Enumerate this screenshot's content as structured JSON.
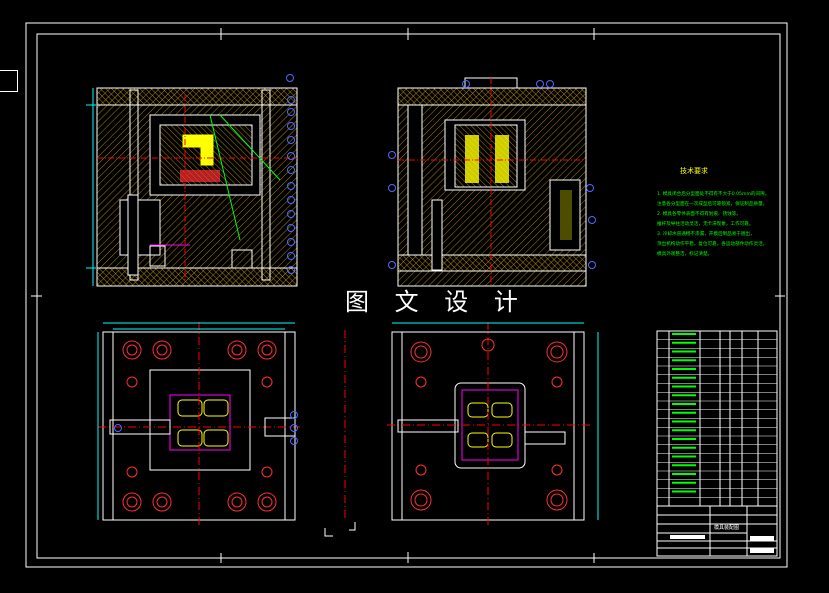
{
  "watermark": "图 文 设 计",
  "tech_requirements": {
    "title": "技术要求",
    "lines": [
      "1. 模具闭合后分型面处不得有不大于0.05mm的间隙。",
      "注意各分型面在一次成型后可靠锁紧，保证制品质量。",
      "2. 模具各零件表面不得有划痕、锈蚀等。",
      "推杆及导柱活动灵活，无卡滞现象，工作可靠。",
      "3. 冷却水道通畅不渗漏，开模后制品易于脱出，",
      "顶出机构动作平稳，复位可靠，各运动部件动作灵活，",
      "模具外观整洁，标记清楚。"
    ]
  },
  "title_block": {
    "drawing_name": "模具装配图"
  },
  "bom_rows": 20,
  "colors": {
    "background": "#000000",
    "frame": "#ffffff",
    "outline": "#ffffff",
    "hatch": "#d6a400",
    "dimension": "#00ffff",
    "leader": "#00ff00",
    "centerline": "#ff0000",
    "cavity": "#ffff00",
    "accent": "#ff00ff",
    "balloon": "#4d6bff"
  }
}
